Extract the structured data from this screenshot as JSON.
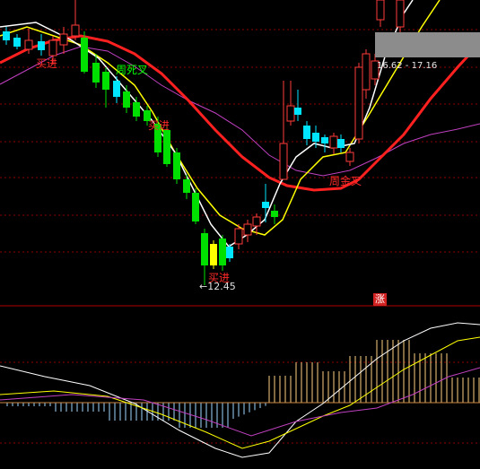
{
  "chart_data": {
    "type": "candlestick",
    "annotations": {
      "low_marker": "12.45",
      "range_label": "16.62 - 17.16",
      "buy_signal": "买进",
      "death_cross": "周死叉",
      "golden_cross": "周金叉",
      "up_badge": "涨"
    },
    "colors": {
      "up": "#ff3b3b",
      "down": "#00e5ff",
      "down_green": "#00e000",
      "ma_white": "#ffffff",
      "ma_yellow": "#ffff00",
      "ma_magenta": "#c040c0",
      "ma_red": "#ff2020",
      "grid": "#8b0000",
      "macd_pos": "#ffd080",
      "macd_neg": "#9fd8ff"
    }
  }
}
